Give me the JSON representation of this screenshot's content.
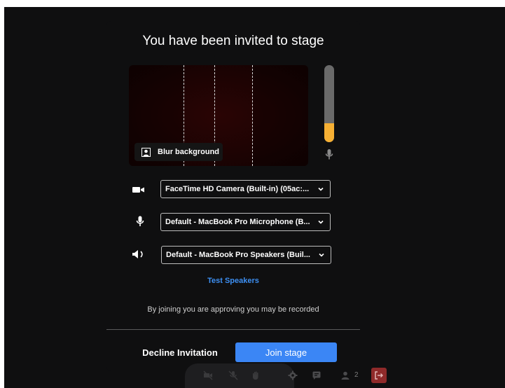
{
  "dialog": {
    "title": "You have been invited to stage"
  },
  "preview": {
    "blur_label": "Blur background",
    "blur_icon": "blur-background-icon"
  },
  "audio_level": {
    "fraction": 0.25,
    "color": "#f6b034",
    "icon": "microphone-icon"
  },
  "devices": {
    "camera": {
      "icon": "camera-icon",
      "value": "FaceTime HD Camera (Built-in) (05ac:..."
    },
    "microphone": {
      "icon": "microphone-icon",
      "value": "Default - MacBook Pro Microphone (B..."
    },
    "speaker": {
      "icon": "speaker-icon",
      "value": "Default - MacBook Pro Speakers (Buil..."
    }
  },
  "test_speakers_label": "Test Speakers",
  "recording_notice": "By joining you are approving you may be recorded",
  "actions": {
    "decline_label": "Decline Invitation",
    "join_label": "Join stage"
  },
  "toolbar": {
    "participant_count": "2",
    "icons": [
      "camera-off-icon",
      "microphone-off-icon",
      "raise-hand-icon",
      "settings-icon",
      "chat-icon",
      "participants-icon",
      "leave-icon"
    ]
  },
  "colors": {
    "accent": "#3b86f5",
    "link": "#3d8ff2",
    "background": "#0f0f10",
    "leave": "#8f2a2a"
  }
}
